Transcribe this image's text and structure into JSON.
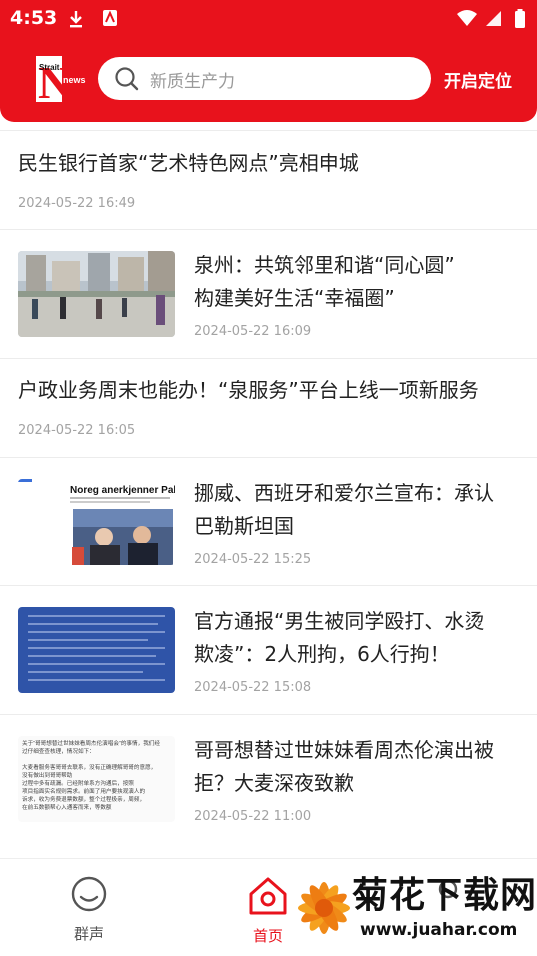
{
  "status_bar": {
    "time": "4:53"
  },
  "header": {
    "logo": {
      "letter": "N",
      "small_text_1": "Strait",
      "small_text_2": "news"
    },
    "search": {
      "placeholder": "新质生产力"
    },
    "locate_label": "开启定位"
  },
  "news": [
    {
      "title": "民生银行首家“艺术特色网点”亮相申城",
      "date": "2024-05-22 16:49"
    },
    {
      "title_line1": "泉州：共筑邻里和谐“同心圆”",
      "title_line2": "构建美好生活“幸福圈”",
      "date": "2024-05-22 16:09"
    },
    {
      "title": "户政业务周末也能办！“泉服务”平台上线一项新服务",
      "date": "2024-05-22 16:05"
    },
    {
      "title_line1": "挪威、西班牙和爱尔兰宣布：承认",
      "title_line2": "巴勒斯坦国",
      "date": "2024-05-22 15:25",
      "thumb_heading": "Noreg anerkjenner Palestina"
    },
    {
      "title_line1": "官方通报“男生被同学殴打、水烫",
      "title_line2": "欺凌”：2人刑拘，6人行拘！",
      "date": "2024-05-22 15:08"
    },
    {
      "title_line1": "哥哥想替过世妹妹看周杰伦演出被",
      "title_line2": "拒？大麦深夜致歉",
      "date": "2024-05-22 11:00",
      "thumb_lines": [
        "关于“哥哥想替过世妹妹看周杰伦演唱会”的事情，我们经",
        "过仔细查查核理，情况如下：",
        "大麦看服务客哥哥去联系，没有正确理解哥哥的意愿，",
        "没有做出到哥哥帮助",
        "过程中多有疏漏。已经附单系方沟通后，按照",
        "项目指面实名规则需求。前面了用户要挟观演人的",
        "诉求，收为务费退票数额，整个过程极亲，周频，",
        "在前五数额帮心入通客而来，等数额"
      ]
    }
  ],
  "bottom_nav": [
    {
      "label": "群声",
      "active": false
    },
    {
      "label": "首页",
      "active": true
    }
  ],
  "watermark": {
    "text": "菊花下载网",
    "url": "www.juahar.com"
  },
  "colors": {
    "brand_red": "#e8121c",
    "text": "#222222",
    "muted": "#a3a3a3"
  }
}
